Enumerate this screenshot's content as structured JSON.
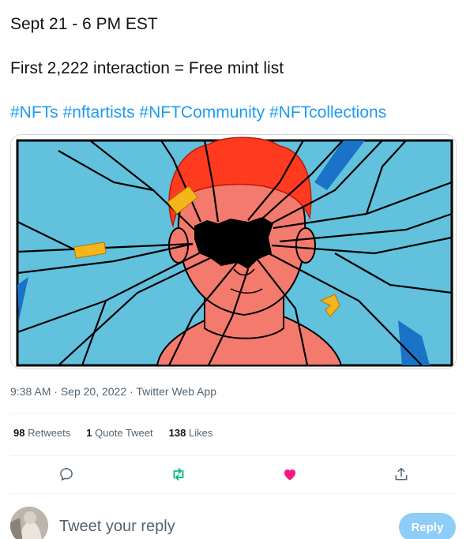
{
  "tweet": {
    "line1": "Sept 21 - 6 PM EST",
    "line2": "First 2,222 interaction = Free mint list",
    "hashtags": [
      "#NFTs",
      "#nftartists",
      "#NFTCommunity",
      "#NFTcollections"
    ]
  },
  "media": {
    "image_icon": "shattered-glass-portrait-illustration",
    "colors": {
      "sky": "#62c1dc",
      "hair": "#ff3a1e",
      "skin": "#f47a6e",
      "tape": "#f6b51a",
      "hole": "#000000"
    }
  },
  "meta": {
    "time": "9:38 AM",
    "sep1": " · ",
    "date": "Sep 20, 2022",
    "sep2": " · ",
    "source": "Twitter Web App"
  },
  "stats": {
    "retweets_count": "98",
    "retweets_label": "Retweets",
    "quotes_count": "1",
    "quotes_label": "Quote Tweet",
    "likes_count": "138",
    "likes_label": "Likes"
  },
  "actions": {
    "reply_icon": "comment-icon",
    "retweet_icon": "retweet-icon",
    "like_icon": "heart-icon",
    "share_icon": "share-icon",
    "retweet_color": "#00ba7c",
    "like_color": "#f91880"
  },
  "reply": {
    "placeholder": "Tweet your reply",
    "button_label": "Reply"
  }
}
